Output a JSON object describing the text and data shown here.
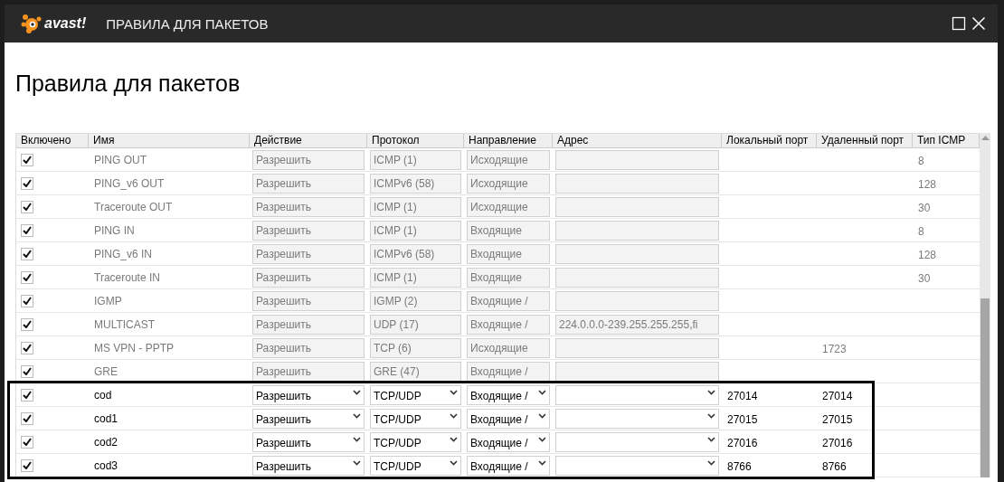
{
  "window": {
    "logo": "avast!",
    "title": "ПРАВИЛА ДЛЯ ПАКЕТОВ"
  },
  "heading": "Правила для пакетов",
  "table": {
    "columns": [
      "Включено",
      "Имя",
      "Действие",
      "Протокол",
      "Направление",
      "Адрес",
      "Локальный порт",
      "Удаленный порт",
      "Тип ICMP"
    ],
    "rows": [
      {
        "kind": "preset",
        "checked": true,
        "highlighted": false,
        "name": "PING OUT",
        "action": "Разрешить",
        "protocol": "ICMP (1)",
        "direction": "Исходящие",
        "address": "",
        "local_port": "",
        "remote_port": "",
        "icmp_type": "8"
      },
      {
        "kind": "preset",
        "checked": true,
        "highlighted": false,
        "name": "PING_v6 OUT",
        "action": "Разрешить",
        "protocol": "ICMPv6 (58)",
        "direction": "Исходящие",
        "address": "",
        "local_port": "",
        "remote_port": "",
        "icmp_type": "128"
      },
      {
        "kind": "preset",
        "checked": true,
        "highlighted": false,
        "name": "Traceroute OUT",
        "action": "Разрешить",
        "protocol": "ICMP (1)",
        "direction": "Исходящие",
        "address": "",
        "local_port": "",
        "remote_port": "",
        "icmp_type": "30"
      },
      {
        "kind": "preset",
        "checked": true,
        "highlighted": false,
        "name": "PING IN",
        "action": "Разрешить",
        "protocol": "ICMP (1)",
        "direction": "Входящие",
        "address": "",
        "local_port": "",
        "remote_port": "",
        "icmp_type": "8"
      },
      {
        "kind": "preset",
        "checked": true,
        "highlighted": false,
        "name": "PING_v6 IN",
        "action": "Разрешить",
        "protocol": "ICMPv6 (58)",
        "direction": "Входящие",
        "address": "",
        "local_port": "",
        "remote_port": "",
        "icmp_type": "128"
      },
      {
        "kind": "preset",
        "checked": true,
        "highlighted": false,
        "name": "Traceroute IN",
        "action": "Разрешить",
        "protocol": "ICMP (1)",
        "direction": "Входящие",
        "address": "",
        "local_port": "",
        "remote_port": "",
        "icmp_type": "30"
      },
      {
        "kind": "preset",
        "checked": true,
        "highlighted": false,
        "name": "IGMP",
        "action": "Разрешить",
        "protocol": "IGMP (2)",
        "direction": "Входящие /",
        "address": "",
        "local_port": "",
        "remote_port": "",
        "icmp_type": ""
      },
      {
        "kind": "preset",
        "checked": true,
        "highlighted": false,
        "name": "MULTICAST",
        "action": "Разрешить",
        "protocol": "UDP (17)",
        "direction": "Входящие /",
        "address": "224.0.0.0-239.255.255.255,fi",
        "local_port": "",
        "remote_port": "",
        "icmp_type": ""
      },
      {
        "kind": "preset",
        "checked": true,
        "highlighted": false,
        "name": "MS VPN - PPTP",
        "action": "Разрешить",
        "protocol": "TCP (6)",
        "direction": "Исходящие",
        "address": "",
        "local_port": "",
        "remote_port": "1723",
        "icmp_type": ""
      },
      {
        "kind": "preset",
        "checked": true,
        "highlighted": false,
        "name": "GRE",
        "action": "Разрешить",
        "protocol": "GRE (47)",
        "direction": "Входящие /",
        "address": "",
        "local_port": "",
        "remote_port": "",
        "icmp_type": ""
      },
      {
        "kind": "custom",
        "checked": true,
        "highlighted": true,
        "name": "cod",
        "action": "Разрешить",
        "protocol": "TCP/UDP",
        "direction": "Входящие /",
        "address": "",
        "local_port": "27014",
        "remote_port": "27014",
        "icmp_type": ""
      },
      {
        "kind": "custom",
        "checked": true,
        "highlighted": true,
        "name": "cod1",
        "action": "Разрешить",
        "protocol": "TCP/UDP",
        "direction": "Входящие /",
        "address": "",
        "local_port": "27015",
        "remote_port": "27015",
        "icmp_type": ""
      },
      {
        "kind": "custom",
        "checked": true,
        "highlighted": true,
        "name": "cod2",
        "action": "Разрешить",
        "protocol": "TCP/UDP",
        "direction": "Входящие /",
        "address": "",
        "local_port": "27016",
        "remote_port": "27016",
        "icmp_type": ""
      },
      {
        "kind": "custom",
        "checked": true,
        "highlighted": true,
        "name": "cod3",
        "action": "Разрешить",
        "protocol": "TCP/UDP",
        "direction": "Входящие /",
        "address": "",
        "local_port": "8766",
        "remote_port": "8766",
        "icmp_type": ""
      }
    ]
  }
}
